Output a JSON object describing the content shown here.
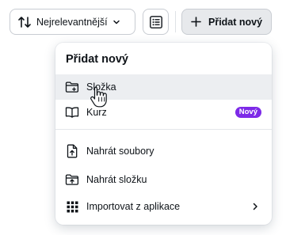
{
  "toolbar": {
    "sort_label": "Nejrelevantnější",
    "add_label": "Přidat nový"
  },
  "menu": {
    "title": "Přidat nový",
    "items": [
      {
        "label": "Složka",
        "icon": "folder-plus-icon"
      },
      {
        "label": "Kurz",
        "icon": "book-open-icon",
        "badge": "Nový"
      },
      {
        "label": "Nahrát soubory",
        "icon": "file-upload-icon"
      },
      {
        "label": "Nahrát složku",
        "icon": "folder-upload-icon"
      },
      {
        "label": "Importovat z aplikace",
        "icon": "apps-grid-icon"
      }
    ]
  },
  "colors": {
    "badge": "#7d2ae8",
    "hover": "#eceef1",
    "border": "#c8ccd2",
    "text": "#0e1318"
  }
}
